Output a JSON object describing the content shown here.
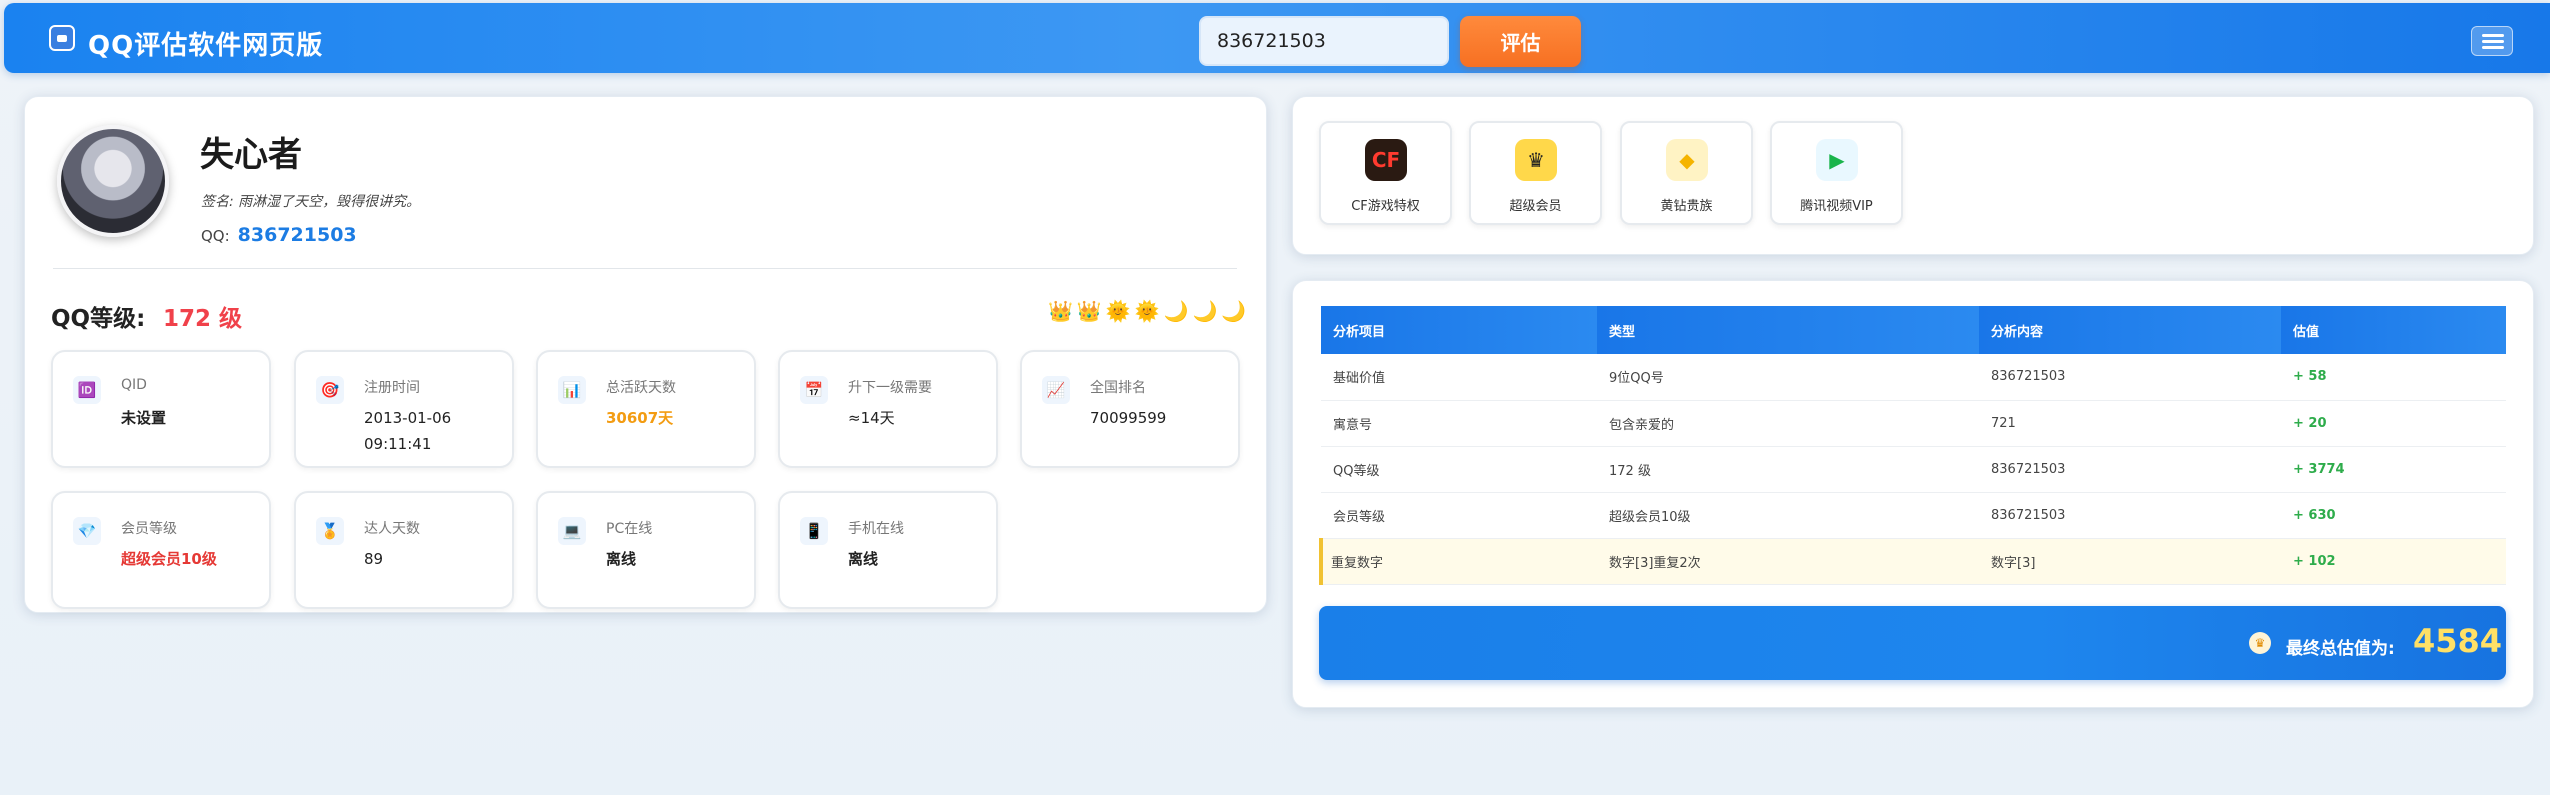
{
  "header": {
    "app_icon": "app-logo-icon",
    "title": "QQ评估软件网页版",
    "search_value": "836721503",
    "search_placeholder": "",
    "evaluate_label": "评估",
    "menu_icon": "hamburger-menu-icon"
  },
  "profile": {
    "nickname": "失心者",
    "signature": "签名: 雨淋湿了天空，毁得很讲究。",
    "qq_label": "QQ:",
    "qq_number": "836721503",
    "level_label": "QQ等级:",
    "level_value": "172 级",
    "level_icons": "👑👑🌞🌞🌙🌙🌙"
  },
  "tiles": [
    {
      "icon": "id-icon",
      "glyph": "🆔",
      "label": "QID",
      "value": "未设置"
    },
    {
      "icon": "target-icon",
      "glyph": "🎯",
      "label": "注册时间",
      "value": "2013-01-06 09:11:41"
    },
    {
      "icon": "chart-icon",
      "glyph": "📊",
      "label": "总活跃天数",
      "value": "30607天"
    },
    {
      "icon": "calendar-icon",
      "glyph": "📅",
      "label": "升下一级需要",
      "value": "≈14天"
    },
    {
      "icon": "trend-icon",
      "glyph": "📈",
      "label": "全国排名",
      "value": "70099599"
    },
    {
      "icon": "diamond-icon",
      "glyph": "💎",
      "label": "会员等级",
      "value": "超级会员10级"
    },
    {
      "icon": "medal-icon",
      "glyph": "🏅",
      "label": "达人天数",
      "value": "89"
    },
    {
      "icon": "laptop-icon",
      "glyph": "💻",
      "label": "PC在线",
      "value": "离线"
    },
    {
      "icon": "phone-icon",
      "glyph": "📱",
      "label": "手机在线",
      "value": "离线"
    }
  ],
  "services": [
    {
      "icon": "cf-game-icon",
      "label": "CF游戏特权"
    },
    {
      "icon": "super-member-icon",
      "label": "超级会员"
    },
    {
      "icon": "yellow-diamond-icon",
      "label": "黄钻贵族"
    },
    {
      "icon": "tencent-video-vip-icon",
      "label": "腾讯视频VIP"
    }
  ],
  "analysis": {
    "headers": [
      "分析项目",
      "类型",
      "分析内容",
      "估值"
    ],
    "rows": [
      [
        "基础价值",
        "9位QQ号",
        "836721503",
        "+ 58"
      ],
      [
        "寓意号",
        "包含亲爱的",
        "721",
        "+ 20"
      ],
      [
        "QQ等级",
        "172 级",
        "836721503",
        "+ 3774"
      ],
      [
        "会员等级",
        "超级会员10级",
        "836721503",
        "+ 630"
      ],
      [
        "重复数字",
        "数字[3]重复2次",
        "数字[3]",
        "+ 102"
      ]
    ],
    "total_label": "最终总估值为:",
    "total_value": "4584"
  },
  "colors": {
    "header_blue": "#1a82f0",
    "accent_orange": "#f77022",
    "score_green": "#2eac4b",
    "level_red": "#f0414a",
    "total_yellow": "#ffe066"
  }
}
